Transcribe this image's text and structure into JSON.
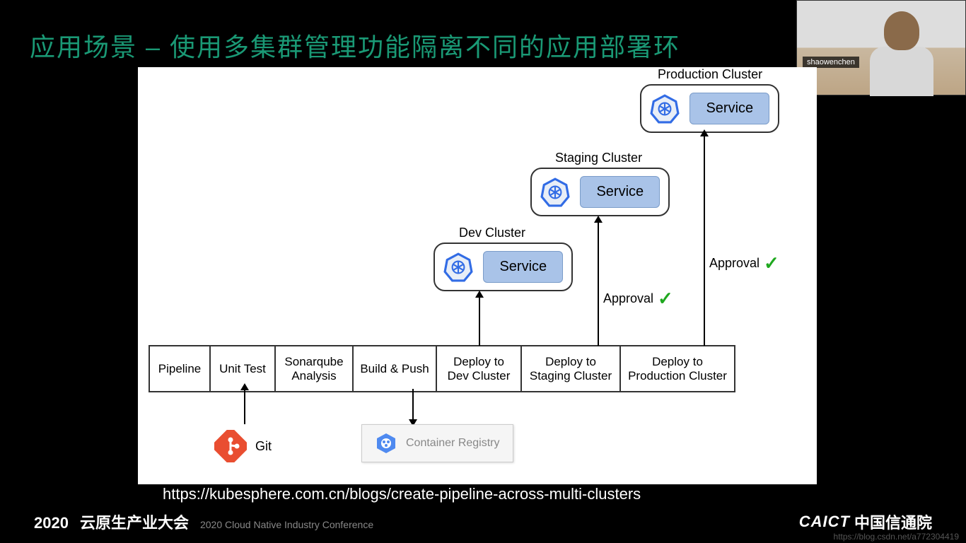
{
  "title": "应用场景 – 使用多集群管理功能隔离不同的应用部署环",
  "webcam": {
    "name": "shaowenchen"
  },
  "clusters": {
    "prod": {
      "label": "Production Cluster",
      "service": "Service"
    },
    "staging": {
      "label": "Staging Cluster",
      "service": "Service"
    },
    "dev": {
      "label": "Dev Cluster",
      "service": "Service"
    }
  },
  "pipeline": {
    "label": "Pipeline",
    "stages": [
      "Unit Test",
      "Sonarqube Analysis",
      "Build & Push",
      "Deploy to Dev Cluster",
      "Deploy to Staging Cluster",
      "Deploy to Production Cluster"
    ]
  },
  "git": {
    "label": "Git"
  },
  "container_registry": {
    "label": "Container Registry"
  },
  "approvals": {
    "staging": "Approval",
    "prod": "Approval"
  },
  "url": "https://kubesphere.com.cn/blogs/create-pipeline-across-multi-clusters",
  "footer": {
    "year": "2020",
    "event_cn": "云原生产业大会",
    "event_en": "2020 Cloud Native Industry Conference",
    "org_en": "CAICT",
    "org_cn": "中国信通院"
  },
  "watermark": "https://blog.csdn.net/a772304419",
  "chart_data": {
    "type": "diagram",
    "title": "Multi-cluster CI/CD Pipeline",
    "nodes": [
      {
        "id": "git",
        "label": "Git",
        "type": "source"
      },
      {
        "id": "unit",
        "label": "Unit Test",
        "type": "stage"
      },
      {
        "id": "sonar",
        "label": "Sonarqube Analysis",
        "type": "stage"
      },
      {
        "id": "build",
        "label": "Build & Push",
        "type": "stage"
      },
      {
        "id": "cr",
        "label": "Container Registry",
        "type": "registry"
      },
      {
        "id": "deploy_dev",
        "label": "Deploy to Dev Cluster",
        "type": "stage"
      },
      {
        "id": "dev_svc",
        "label": "Service",
        "cluster": "Dev Cluster",
        "type": "k8s"
      },
      {
        "id": "deploy_stg",
        "label": "Deploy to Staging Cluster",
        "type": "stage"
      },
      {
        "id": "stg_svc",
        "label": "Service",
        "cluster": "Staging Cluster",
        "type": "k8s"
      },
      {
        "id": "deploy_prod",
        "label": "Deploy to Production Cluster",
        "type": "stage"
      },
      {
        "id": "prod_svc",
        "label": "Service",
        "cluster": "Production Cluster",
        "type": "k8s"
      }
    ],
    "edges": [
      {
        "from": "git",
        "to": "unit"
      },
      {
        "from": "unit",
        "to": "sonar"
      },
      {
        "from": "sonar",
        "to": "build"
      },
      {
        "from": "build",
        "to": "cr"
      },
      {
        "from": "build",
        "to": "deploy_dev"
      },
      {
        "from": "deploy_dev",
        "to": "dev_svc"
      },
      {
        "from": "deploy_dev",
        "to": "deploy_stg"
      },
      {
        "from": "deploy_stg",
        "to": "stg_svc",
        "label": "Approval"
      },
      {
        "from": "deploy_stg",
        "to": "deploy_prod"
      },
      {
        "from": "deploy_prod",
        "to": "prod_svc",
        "label": "Approval"
      }
    ]
  }
}
